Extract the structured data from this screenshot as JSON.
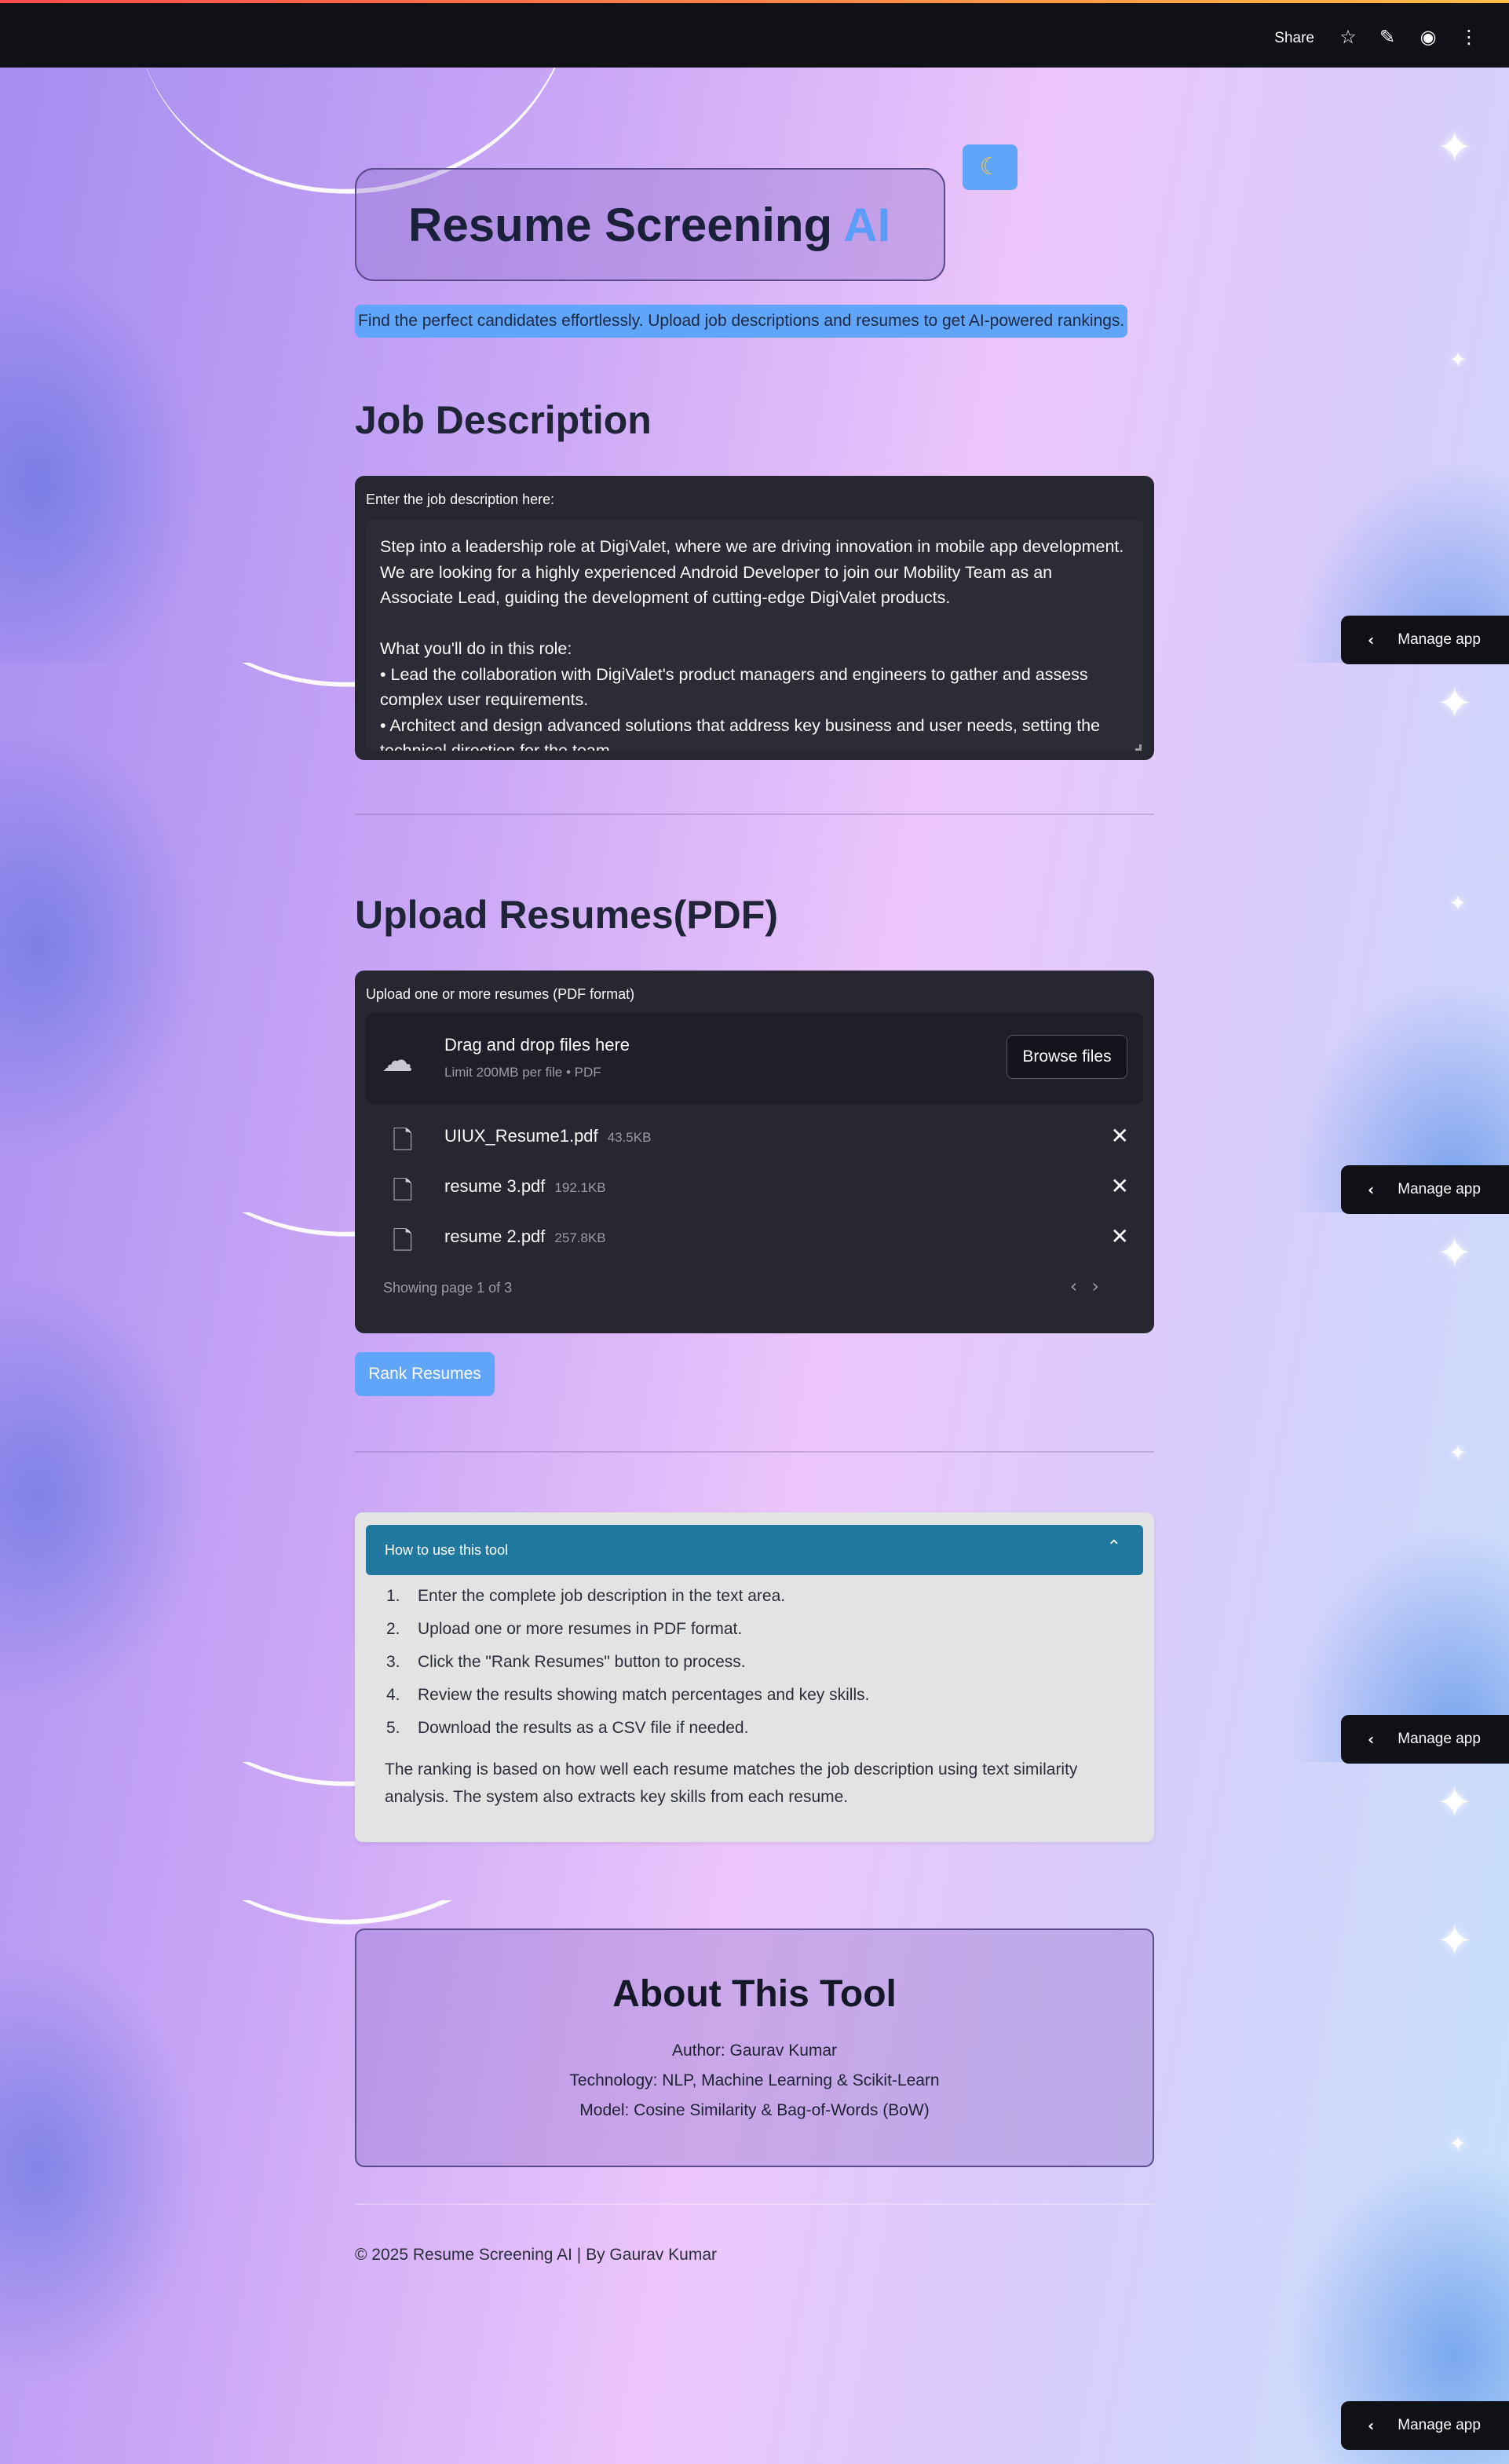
{
  "toolbar": {
    "share_label": "Share",
    "icons": [
      "star-icon",
      "pencil-icon",
      "github-icon",
      "more-vertical-icon"
    ]
  },
  "manage_app": {
    "label": "Manage app"
  },
  "header": {
    "title_main": "Resume Screening",
    "title_accent": "AI",
    "theme_toggle_icon": "moon-icon",
    "subtitle": "Find the perfect candidates effortlessly. Upload job descriptions and resumes to get AI-powered rankings."
  },
  "job_description": {
    "heading": "Job Description",
    "input_label": "Enter the job description here:",
    "value": "Step into a leadership role at DigiValet, where we are driving innovation in mobile app development. We are looking for a highly experienced Android Developer to join our Mobility Team as an Associate Lead, guiding the development of cutting-edge DigiValet products.\n\nWhat you'll do in this role:\n• Lead the collaboration with DigiValet's product managers and engineers to gather and assess complex user requirements.\n• Architect and design advanced solutions that address key business and user needs, setting the technical direction for the team."
  },
  "upload": {
    "heading": "Upload Resumes(PDF)",
    "input_label": "Upload one or more resumes (PDF format)",
    "dropzone_title": "Drag and drop files here",
    "dropzone_hint": "Limit 200MB per file • PDF",
    "browse_label": "Browse files",
    "files": [
      {
        "name": "UIUX_Resume1.pdf",
        "size": "43.5KB"
      },
      {
        "name": "resume 3.pdf",
        "size": "192.1KB"
      },
      {
        "name": "resume 2.pdf",
        "size": "257.8KB"
      }
    ],
    "pagination": "Showing page 1 of 3"
  },
  "rank_button": {
    "label": "Rank Resumes"
  },
  "how_to": {
    "title": "How to use this tool",
    "steps": [
      {
        "num": "1.",
        "text": "Enter the complete job description in the text area."
      },
      {
        "num": "2.",
        "text": "Upload one or more resumes in PDF format."
      },
      {
        "num": "3.",
        "text": "Click the \"Rank Resumes\" button to process."
      },
      {
        "num": "4.",
        "text": "Review the results showing match percentages and key skills."
      },
      {
        "num": "5.",
        "text": "Download the results as a CSV file if needed."
      }
    ],
    "note": "The ranking is based on how well each resume matches the job description using text similarity analysis. The system also extracts key skills from each resume."
  },
  "about": {
    "heading": "About This Tool",
    "author": "Author: Gaurav Kumar",
    "technology": "Technology: NLP, Machine Learning & Scikit-Learn",
    "model": "Model: Cosine Similarity & Bag-of-Words (BoW)"
  },
  "footer": {
    "text": "© 2025 Resume Screening AI | By Gaurav Kumar"
  },
  "colors": {
    "accent": "#60a5fa",
    "toolbar_bg": "#0f1117",
    "card_bg": "#262730",
    "expander_header": "#21789e"
  }
}
